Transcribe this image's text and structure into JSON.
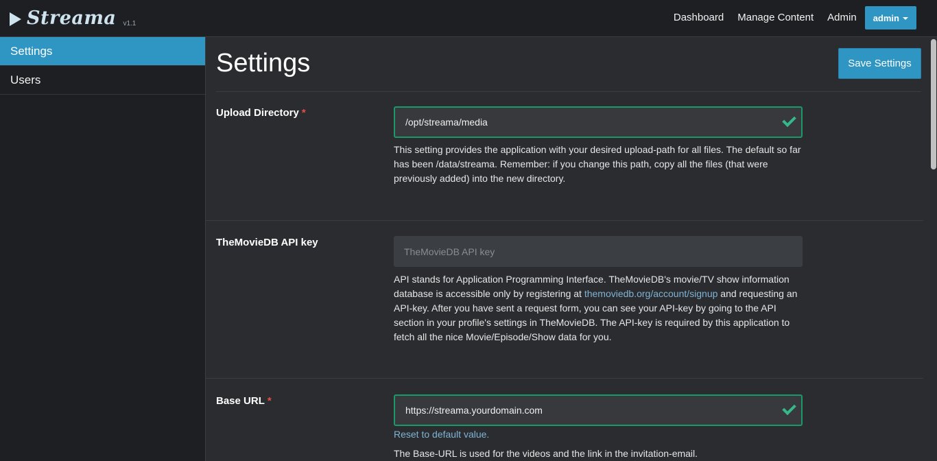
{
  "brand": {
    "name": "Streama",
    "version": "v1.1",
    "icon": "play-icon"
  },
  "nav": {
    "dashboard": "Dashboard",
    "manage_content": "Manage Content",
    "admin": "Admin",
    "user_menu": "admin"
  },
  "sidebar": {
    "items": [
      {
        "label": "Settings",
        "active": true
      },
      {
        "label": "Users",
        "active": false
      }
    ]
  },
  "page": {
    "title": "Settings",
    "save_label": "Save Settings"
  },
  "settings": {
    "upload_directory": {
      "label": "Upload Directory",
      "required_mark": "*",
      "value": "/opt/streama/media",
      "help": "This setting provides the application with your desired upload-path for all files. The default so far has been /data/streama. Remember: if you change this path, copy all the files (that were previously added) into the new directory."
    },
    "tmdb_api_key": {
      "label": "TheMovieDB API key",
      "placeholder": "TheMovieDB API key",
      "help_before": "API stands for Application Programming Interface. TheMovieDB's movie/TV show information database is accessible only by registering at ",
      "help_link": "themoviedb.org/account/signup",
      "help_after": " and requesting an API-key. After you have sent a request form, you can see your API-key by going to the API section in your profile's settings in TheMovieDB. The API-key is required by this application to fetch all the nice Movie/Episode/Show data for you."
    },
    "base_url": {
      "label": "Base URL",
      "required_mark": "*",
      "value": "https://streama.yourdomain.com",
      "reset_label": "Reset to default value.",
      "help": "The Base-URL is used for the videos and the link in the invitation-email."
    }
  },
  "colors": {
    "accent": "#2f95c3",
    "valid": "#1a9a6a",
    "required": "#e84d4d",
    "link": "#7fb4d4"
  }
}
